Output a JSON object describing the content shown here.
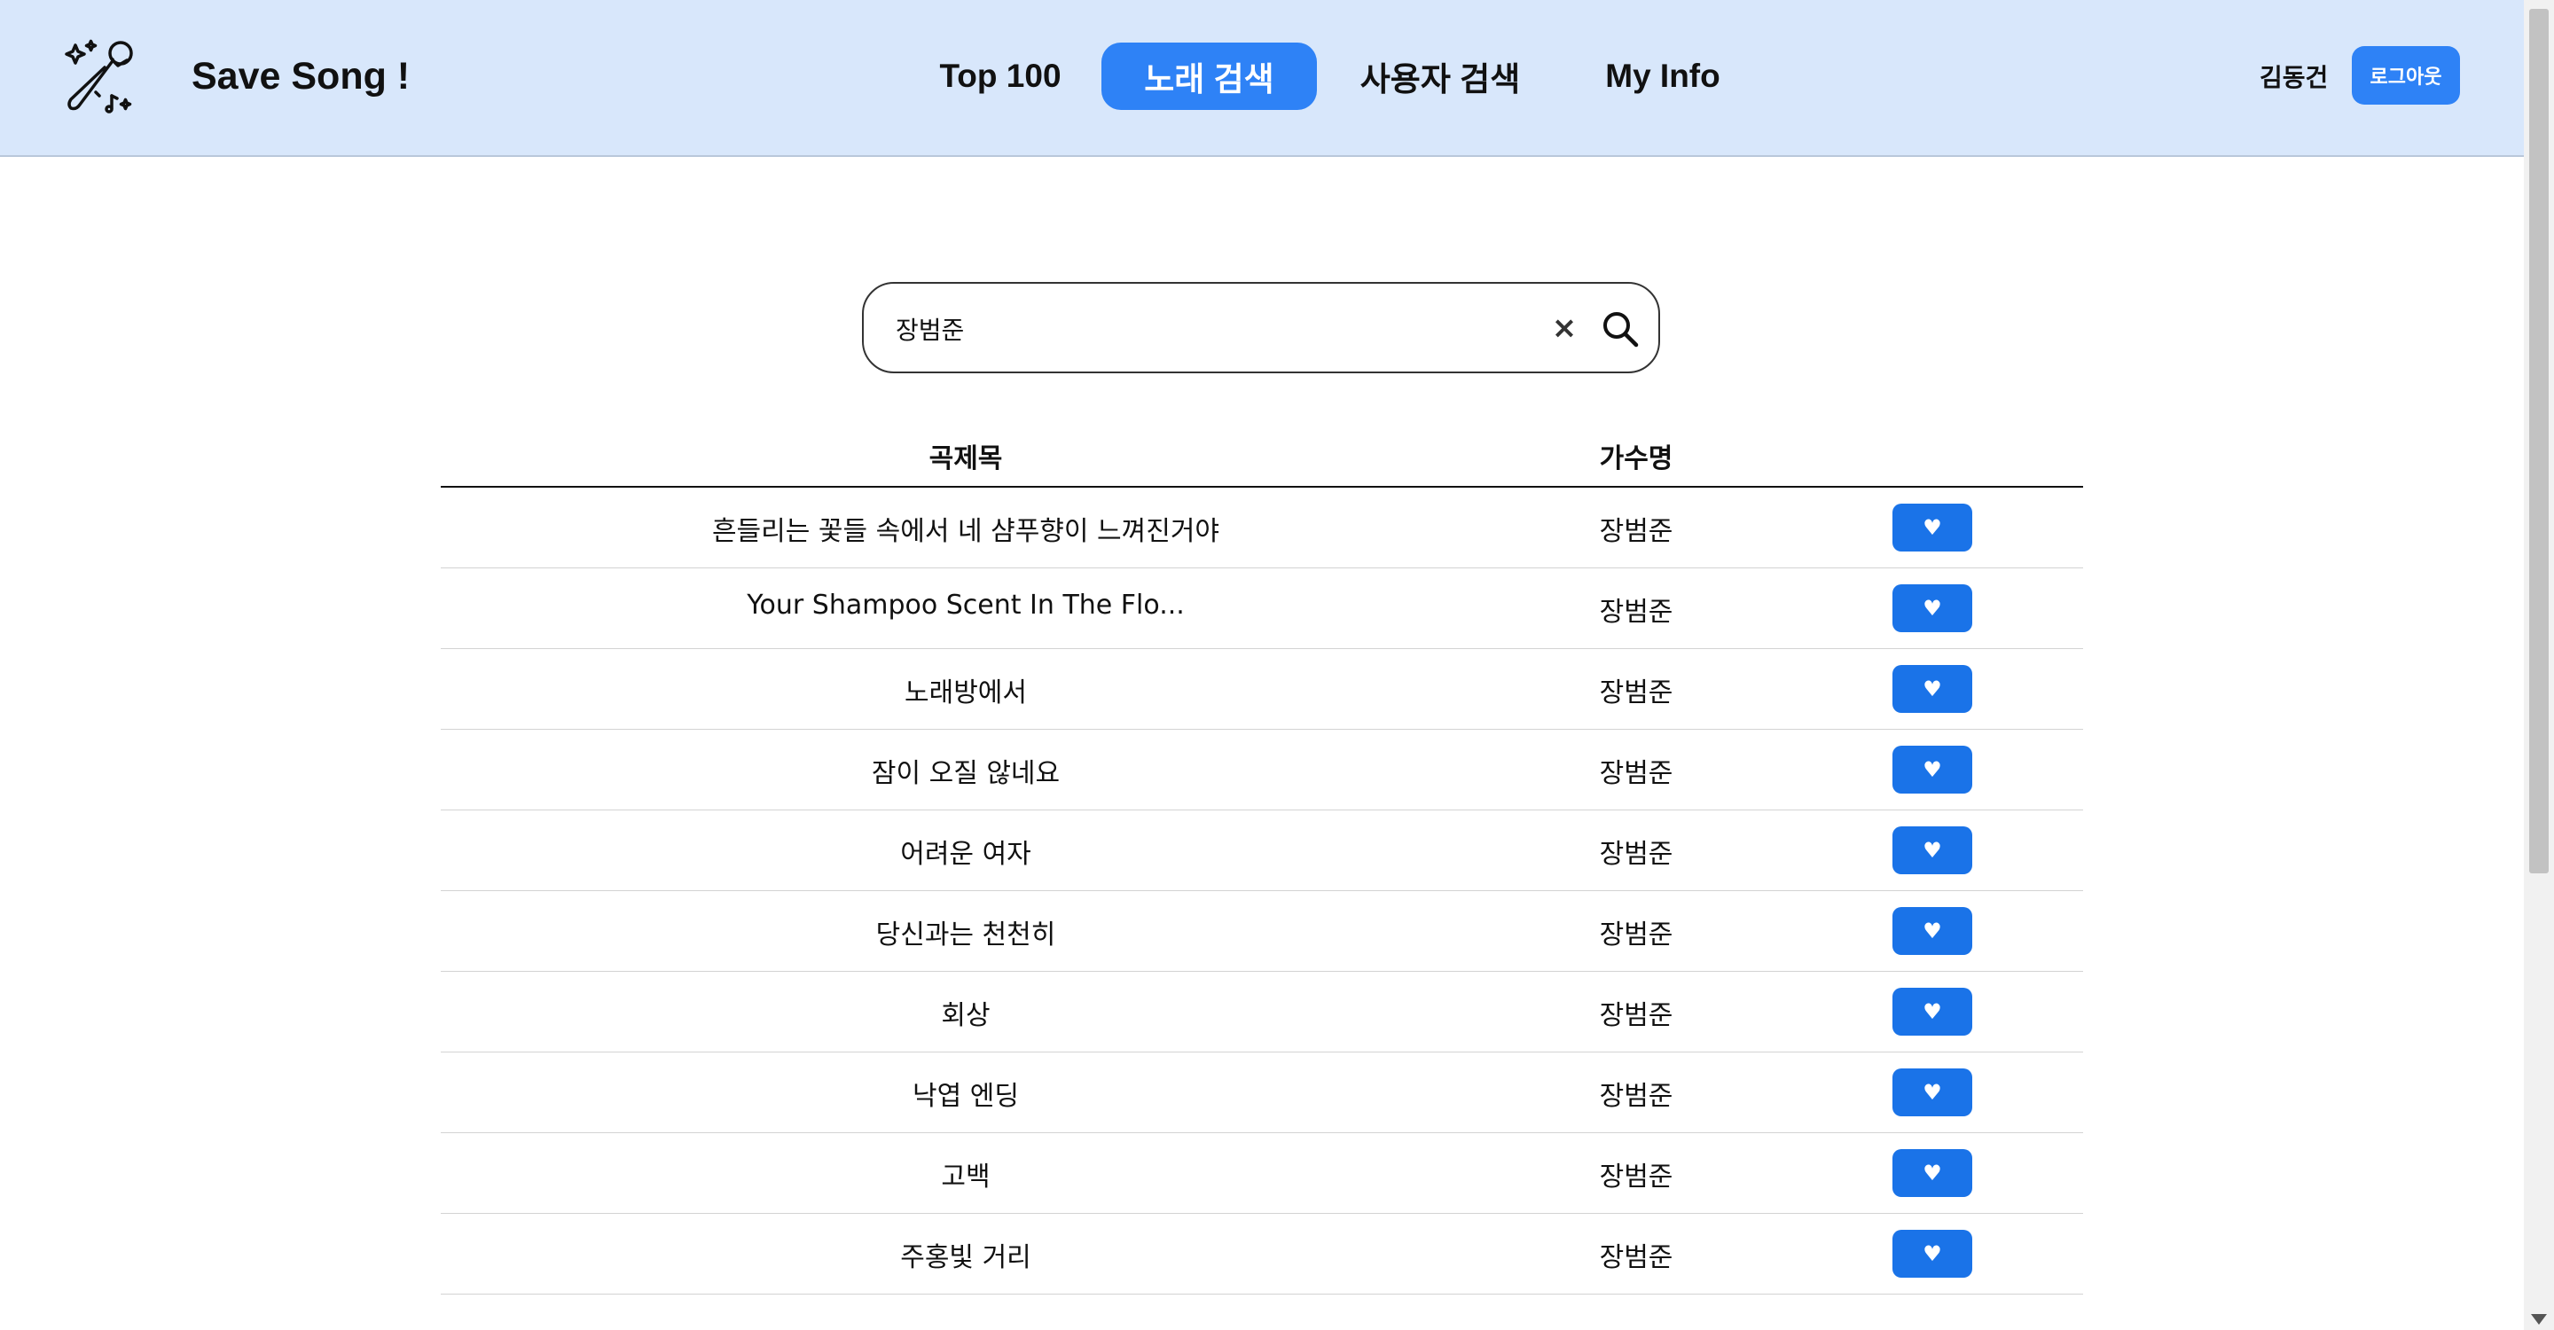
{
  "header": {
    "logo_text": "Save Song !",
    "nav": [
      "Top 100",
      "노래 검색",
      "사용자 검색",
      "My Info"
    ],
    "username": "김동건",
    "logout_label": "로그아웃"
  },
  "search": {
    "value": "장범준",
    "clear_label": "×"
  },
  "table": {
    "headers": [
      "곡제목",
      "가수명"
    ],
    "like_label": "♥",
    "rows": [
      {
        "title": "흔들리는 꽃들 속에서 네 샴푸향이 느껴진거야",
        "artist": "장범준"
      },
      {
        "title": "Your Shampoo Scent In The Flo...",
        "artist": "장범준"
      },
      {
        "title": "노래방에서",
        "artist": "장범준"
      },
      {
        "title": "잠이 오질 않네요",
        "artist": "장범준"
      },
      {
        "title": "어려운 여자",
        "artist": "장범준"
      },
      {
        "title": "당신과는 천천히",
        "artist": "장범준"
      },
      {
        "title": "회상",
        "artist": "장범준"
      },
      {
        "title": "낙엽 엔딩",
        "artist": "장범준"
      },
      {
        "title": "고백",
        "artist": "장범준"
      },
      {
        "title": "주홍빛 거리",
        "artist": "장범준"
      }
    ]
  },
  "colors": {
    "header_bg": "#d8e7fb",
    "accent": "#2e82f6",
    "like_button": "#1a73e8"
  },
  "icons": {
    "logo": "microphone-sparkle-icon",
    "search": "search-icon",
    "clear": "close-icon",
    "like": "heart-icon"
  }
}
